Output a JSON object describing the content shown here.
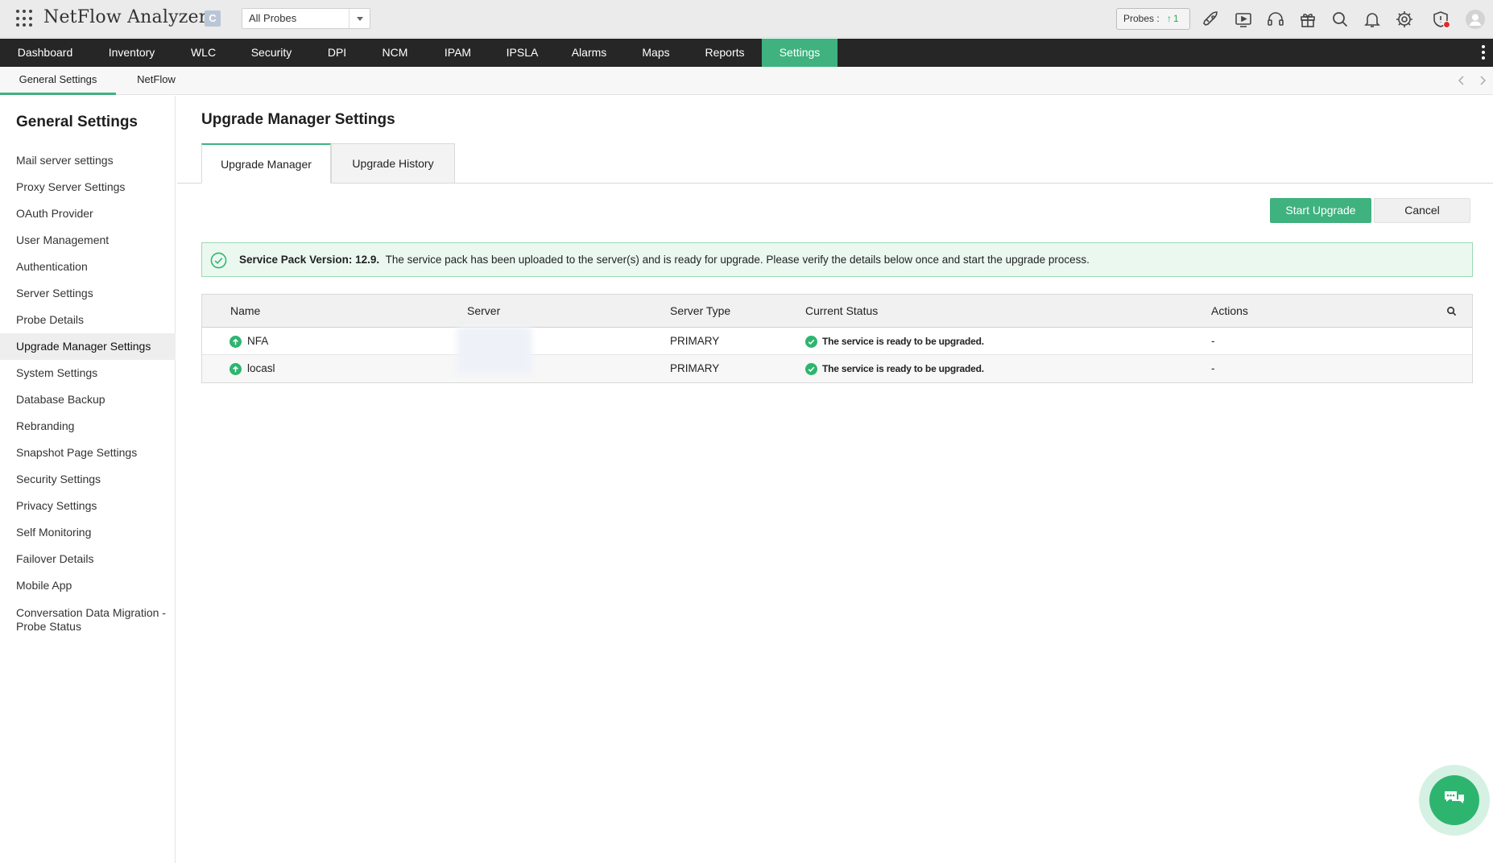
{
  "app": {
    "title": "NetFlow Analyzer",
    "badge": "C",
    "probe_select": "All Probes",
    "probes_label": "Probes :",
    "probes_up_count": "1"
  },
  "topbar_icons": [
    "rocket-icon",
    "video-icon",
    "headset-icon",
    "gift-icon",
    "search-icon",
    "bell-icon",
    "gear-icon",
    "shield-alert-icon",
    "user-avatar-icon"
  ],
  "main_nav": [
    {
      "label": "Dashboard"
    },
    {
      "label": "Inventory"
    },
    {
      "label": "WLC"
    },
    {
      "label": "Security"
    },
    {
      "label": "DPI"
    },
    {
      "label": "NCM"
    },
    {
      "label": "IPAM"
    },
    {
      "label": "IPSLA"
    },
    {
      "label": "Alarms"
    },
    {
      "label": "Maps"
    },
    {
      "label": "Reports"
    },
    {
      "label": "Settings"
    }
  ],
  "main_nav_active": "Settings",
  "sub_nav": [
    {
      "label": "General Settings"
    },
    {
      "label": "NetFlow"
    }
  ],
  "sidebar": {
    "title": "General Settings",
    "items": [
      {
        "label": "Mail server settings"
      },
      {
        "label": "Proxy Server Settings"
      },
      {
        "label": "OAuth Provider"
      },
      {
        "label": "User Management"
      },
      {
        "label": "Authentication"
      },
      {
        "label": "Server Settings"
      },
      {
        "label": "Probe Details"
      },
      {
        "label": "Upgrade Manager Settings"
      },
      {
        "label": "System Settings"
      },
      {
        "label": "Database Backup"
      },
      {
        "label": "Rebranding"
      },
      {
        "label": "Snapshot Page Settings"
      },
      {
        "label": "Security Settings"
      },
      {
        "label": "Privacy Settings"
      },
      {
        "label": "Self Monitoring"
      },
      {
        "label": "Failover Details"
      },
      {
        "label": "Mobile App"
      },
      {
        "label": "Conversation Data Migration - Probe Status"
      }
    ],
    "active": "Upgrade Manager Settings"
  },
  "main": {
    "title": "Upgrade Manager Settings",
    "tabs": [
      {
        "label": "Upgrade Manager"
      },
      {
        "label": "Upgrade History"
      }
    ],
    "start_upgrade_label": "Start Upgrade",
    "cancel_label": "Cancel",
    "alert": {
      "bold": "Service Pack Version: 12.9.",
      "text": "The service pack has been uploaded to the server(s) and is ready for upgrade. Please verify the details below once and start the upgrade process."
    },
    "table": {
      "columns": [
        "Name",
        "Server",
        "Server Type",
        "Current Status",
        "Actions"
      ],
      "rows": [
        {
          "name": "NFA",
          "server": "",
          "server_type": "PRIMARY",
          "status": "The service is ready to be upgraded.",
          "actions": "-"
        },
        {
          "name": "locasl",
          "server": "",
          "server_type": "PRIMARY",
          "status": "The service is ready to be upgraded.",
          "actions": "-"
        }
      ]
    }
  },
  "colors": {
    "accent": "#3fb27f",
    "nav_bg": "#262626",
    "alert_bg": "#ebf8f0",
    "alert_border": "#9ad9b4"
  }
}
